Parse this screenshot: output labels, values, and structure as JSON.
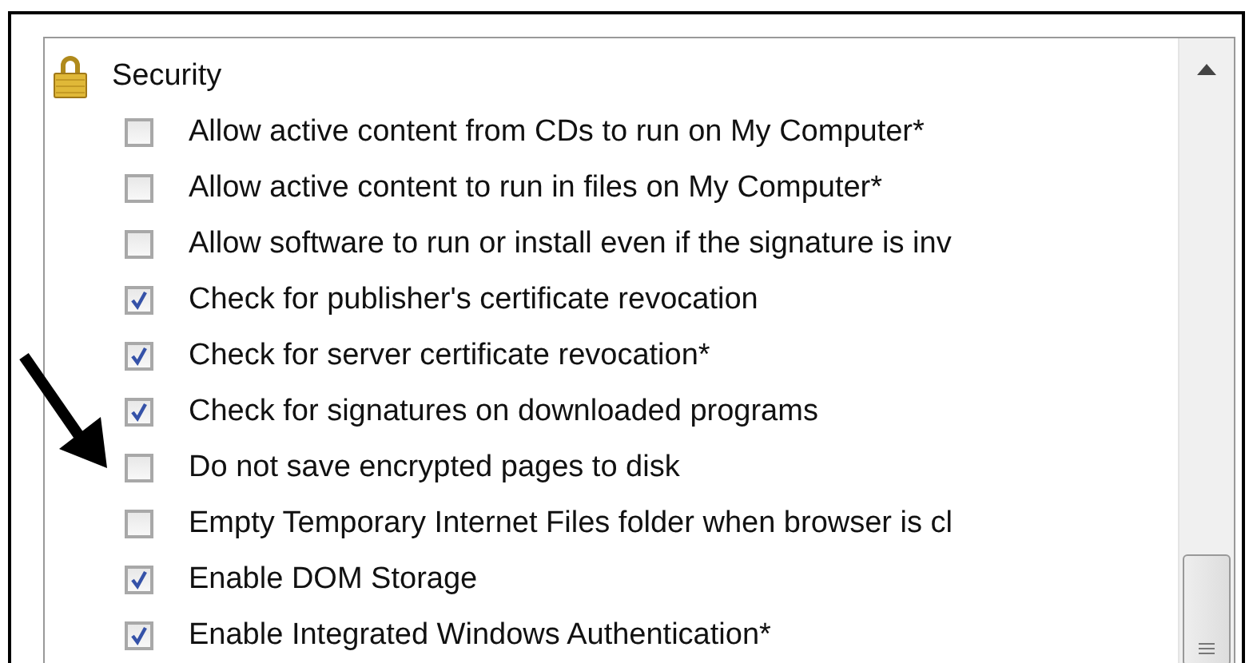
{
  "group": {
    "label": "Security"
  },
  "options": [
    {
      "label": "Allow active content from CDs to run on My Computer*",
      "checked": false
    },
    {
      "label": "Allow active content to run in files on My Computer*",
      "checked": false
    },
    {
      "label": "Allow software to run or install even if the signature is inv",
      "checked": false
    },
    {
      "label": "Check for publisher's certificate revocation",
      "checked": true
    },
    {
      "label": "Check for server certificate revocation*",
      "checked": true
    },
    {
      "label": "Check for signatures on downloaded programs",
      "checked": true
    },
    {
      "label": "Do not save encrypted pages to disk",
      "checked": false
    },
    {
      "label": "Empty Temporary Internet Files folder when browser is cl",
      "checked": false
    },
    {
      "label": "Enable DOM Storage",
      "checked": true
    },
    {
      "label": "Enable Integrated Windows Authentication*",
      "checked": true
    }
  ]
}
